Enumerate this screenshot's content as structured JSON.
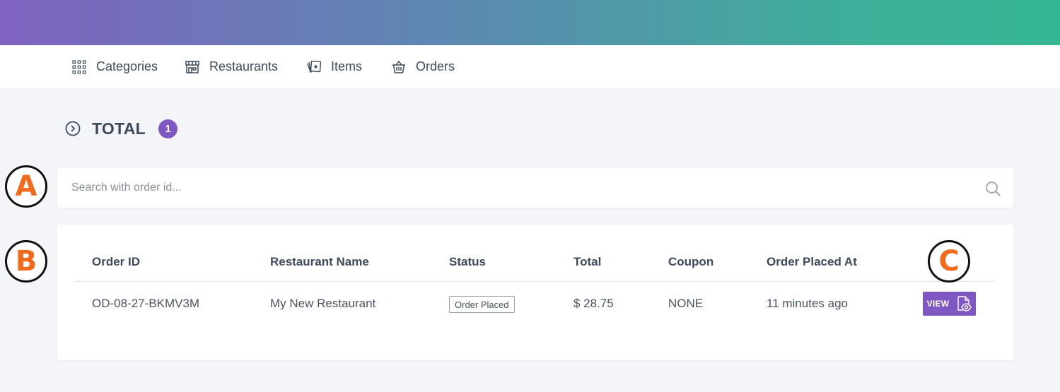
{
  "colors": {
    "accent": "#7e57c2",
    "marker_text": "#f26a1b",
    "gradient_start": "#7f63c0",
    "gradient_end": "#35b793"
  },
  "nav": {
    "items": [
      {
        "label": "Categories",
        "icon": "grid-icon"
      },
      {
        "label": "Restaurants",
        "icon": "store-icon"
      },
      {
        "label": "Items",
        "icon": "images-icon"
      },
      {
        "label": "Orders",
        "icon": "basket-icon"
      }
    ]
  },
  "heading": {
    "title": "TOTAL",
    "count": "1"
  },
  "search": {
    "placeholder": "Search with order id...",
    "value": ""
  },
  "table": {
    "columns": [
      "Order ID",
      "Restaurant Name",
      "Status",
      "Total",
      "Coupon",
      "Order Placed At"
    ],
    "rows": [
      {
        "order_id": "OD-08-27-BKMV3M",
        "restaurant": "My New Restaurant",
        "status": "Order Placed",
        "total": "$ 28.75",
        "coupon": "NONE",
        "placed_at": "11 minutes ago",
        "action": "VIEW"
      }
    ]
  },
  "markers": {
    "a": "A",
    "b": "B",
    "c": "C"
  }
}
